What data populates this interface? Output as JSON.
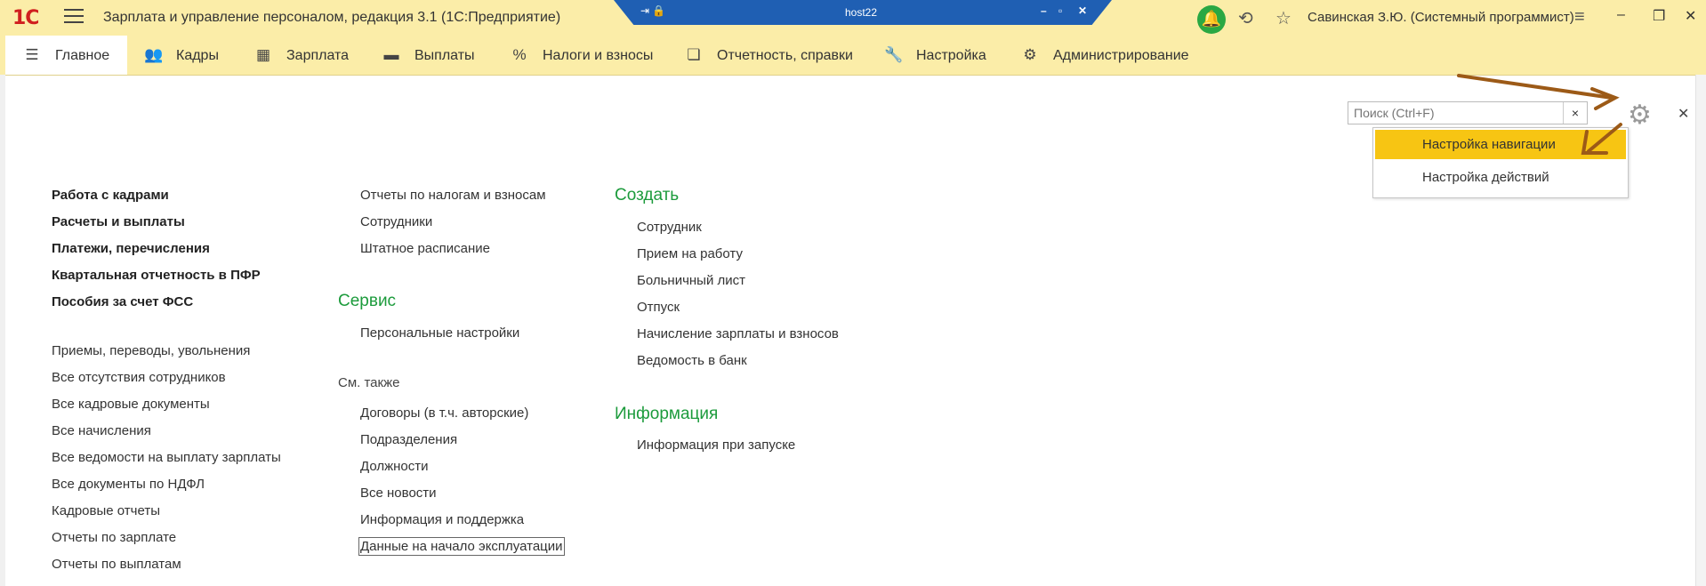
{
  "window": {
    "logo": "1С",
    "title": "Зарплата и управление персоналом, редакция 3.1  (1С:Предприятие)",
    "rdp_host": "host22",
    "user": "Савинская З.Ю. (Системный программист)"
  },
  "icons": {
    "menu": "hamburger-icon",
    "bell": "bell-icon",
    "history": "history-icon",
    "favorite": "star-icon",
    "settings": "gear-icon"
  },
  "sections": [
    {
      "label": "Главное",
      "icon": "list-icon",
      "active": true
    },
    {
      "label": "Кадры",
      "icon": "people-icon"
    },
    {
      "label": "Зарплата",
      "icon": "calculator-icon"
    },
    {
      "label": "Выплаты",
      "icon": "wallet-icon"
    },
    {
      "label": "Налоги и взносы",
      "icon": "percent-icon"
    },
    {
      "label": "Отчетность, справки",
      "icon": "documents-icon"
    },
    {
      "label": "Настройка",
      "icon": "wrench-icon"
    },
    {
      "label": "Администрирование",
      "icon": "gear-icon"
    }
  ],
  "search": {
    "placeholder": "Поиск (Ctrl+F)",
    "clear": "×"
  },
  "settings_menu": {
    "items": [
      "Настройка навигации",
      "Настройка действий"
    ]
  },
  "column1": {
    "important": [
      "Работа с кадрами",
      "Расчеты и выплаты",
      "Платежи, перечисления",
      "Квартальная отчетность в ПФР",
      "Пособия за счет ФСС"
    ],
    "links": [
      "Приемы, переводы, увольнения",
      "Все отсутствия сотрудников",
      "Все кадровые документы",
      "Все начисления",
      "Все ведомости на выплату зарплаты",
      "Все документы по НДФЛ",
      "Кадровые отчеты",
      "Отчеты по зарплате",
      "Отчеты по выплатам"
    ]
  },
  "column2": {
    "links_top": [
      "Отчеты по налогам и взносам",
      "Сотрудники",
      "Штатное расписание"
    ],
    "service_header": "Сервис",
    "service_links": [
      "Персональные настройки"
    ],
    "see_also_header": "См. также",
    "see_also_links": [
      "Договоры (в т.ч. авторские)",
      "Подразделения",
      "Должности",
      "Все новости",
      "Информация и поддержка",
      "Данные на начало эксплуатации"
    ]
  },
  "column3": {
    "create_header": "Создать",
    "create_links": [
      "Сотрудник",
      "Прием на работу",
      "Больничный лист",
      "Отпуск",
      "Начисление зарплаты и взносов",
      "Ведомость в банк"
    ],
    "info_header": "Информация",
    "info_links": [
      "Информация при запуске"
    ]
  },
  "colors": {
    "bar": "#fbeda8",
    "highlight": "#f7c513",
    "header_green": "#1c9b3c",
    "arrow": "#9c5a17"
  }
}
